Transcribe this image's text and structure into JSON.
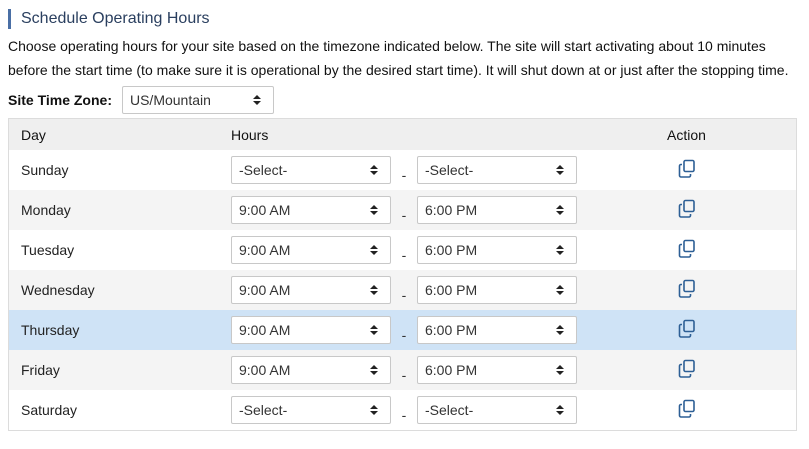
{
  "section": {
    "title": "Schedule Operating Hours",
    "description": "Choose operating hours for your site based on the timezone indicated below. The site will start activating about 10 minutes before the start time (to make sure it is operational by the desired start time). It will shut down at or just after the stopping time."
  },
  "timezone": {
    "label": "Site Time Zone:",
    "value": "US/Mountain"
  },
  "table": {
    "headers": {
      "day": "Day",
      "hours": "Hours",
      "action": "Action"
    },
    "separator": "-",
    "rows": [
      {
        "day": "Sunday",
        "start": "-Select-",
        "end": "-Select-"
      },
      {
        "day": "Monday",
        "start": "9:00 AM",
        "end": "6:00 PM"
      },
      {
        "day": "Tuesday",
        "start": "9:00 AM",
        "end": "6:00 PM"
      },
      {
        "day": "Wednesday",
        "start": "9:00 AM",
        "end": "6:00 PM"
      },
      {
        "day": "Thursday",
        "start": "9:00 AM",
        "end": "6:00 PM",
        "selected": true
      },
      {
        "day": "Friday",
        "start": "9:00 AM",
        "end": "6:00 PM"
      },
      {
        "day": "Saturday",
        "start": "-Select-",
        "end": "-Select-"
      }
    ],
    "action_icon": "copy-icon"
  },
  "colors": {
    "accent": "#4a6fa5",
    "icon": "#2d5f95",
    "row_alt": "#f4f4f4",
    "row_selected": "#cfe3f6",
    "header_bg": "#efefef"
  }
}
